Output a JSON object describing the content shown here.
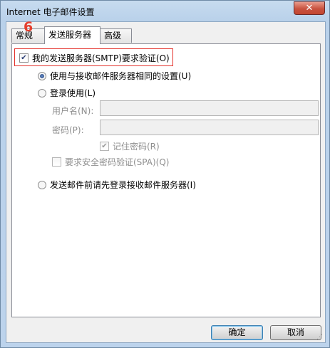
{
  "window": {
    "title": "Internet 电子邮件设置",
    "close_label": "✕"
  },
  "tabs": [
    {
      "label": "常规"
    },
    {
      "label": "发送服务器"
    },
    {
      "label": "高级"
    }
  ],
  "annotation": {
    "step": "6"
  },
  "outgoing": {
    "smtp_auth": {
      "label": "我的发送服务器(SMTP)要求验证(O)",
      "mark": "✔"
    },
    "same_as_incoming": {
      "label": "使用与接收邮件服务器相同的设置(U)"
    },
    "log_on_using": {
      "label": "登录使用(L)"
    },
    "username": {
      "label": "用户名(N):",
      "value": ""
    },
    "password": {
      "label": "密码(P):",
      "value": ""
    },
    "remember_password": {
      "label": "记住密码(R)",
      "mark": "✔"
    },
    "spa": {
      "label": "要求安全密码验证(SPA)(Q)"
    },
    "log_on_incoming_first": {
      "label": "发送邮件前请先登录接收邮件服务器(I)"
    }
  },
  "buttons": {
    "ok": "确定",
    "cancel": "取消"
  },
  "resize_grip": "⋰"
}
